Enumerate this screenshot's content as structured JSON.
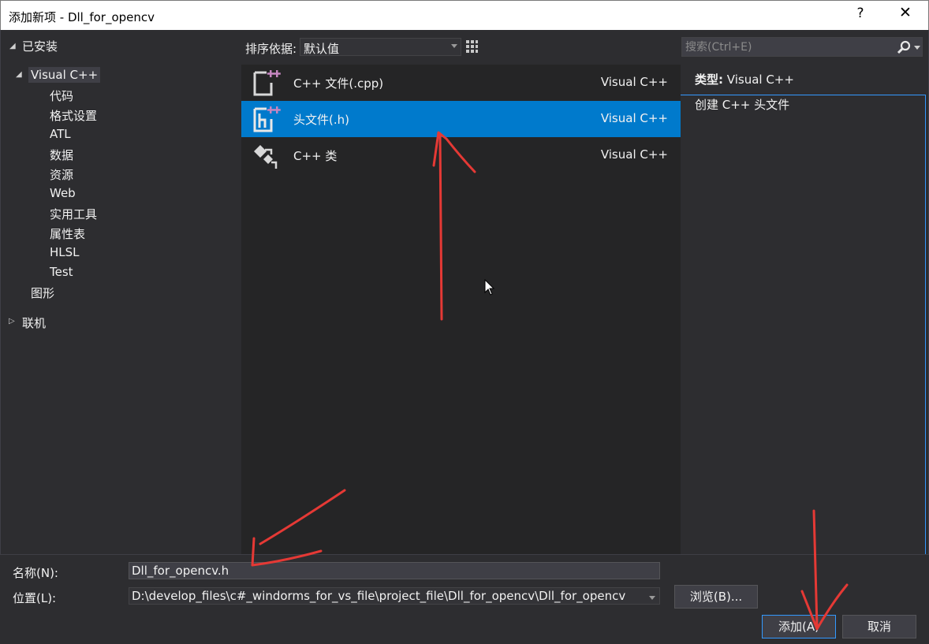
{
  "window": {
    "title": "添加新项 - Dll_for_opencv",
    "help_label": "?",
    "close_label": "✕"
  },
  "tree": {
    "installed": "已安装",
    "visual_cpp": "Visual C++",
    "children": [
      "代码",
      "格式设置",
      "ATL",
      "数据",
      "资源",
      "Web",
      "实用工具",
      "属性表",
      "HLSL",
      "Test"
    ],
    "graphics": "图形",
    "online": "联机"
  },
  "sortbar": {
    "label": "排序依据:",
    "value": "默认值"
  },
  "templates": [
    {
      "name": "C++ 文件(.cpp)",
      "lang": "Visual C++",
      "icon": "cpp-file-icon",
      "selected": false
    },
    {
      "name": "头文件(.h)",
      "lang": "Visual C++",
      "icon": "header-file-icon",
      "selected": true
    },
    {
      "name": "C++ 类",
      "lang": "Visual C++",
      "icon": "cpp-class-icon",
      "selected": false
    }
  ],
  "search": {
    "placeholder": "搜索(Ctrl+E)"
  },
  "info": {
    "type_label": "类型:",
    "type_value": "Visual C++",
    "description": "创建 C++ 头文件"
  },
  "form": {
    "name_label": "名称(N):",
    "name_value": "Dll_for_opencv.h",
    "location_label": "位置(L):",
    "location_value": "D:\\develop_files\\c#_windorms_for_vs_file\\project_file\\Dll_for_opencv\\Dll_for_opencv",
    "browse_label": "浏览(B)...",
    "add_label": "添加(A)",
    "cancel_label": "取消"
  },
  "colors": {
    "background": "#2d2d30",
    "list_background": "#252526",
    "selection": "#007acc",
    "annotation": "#e53935"
  }
}
